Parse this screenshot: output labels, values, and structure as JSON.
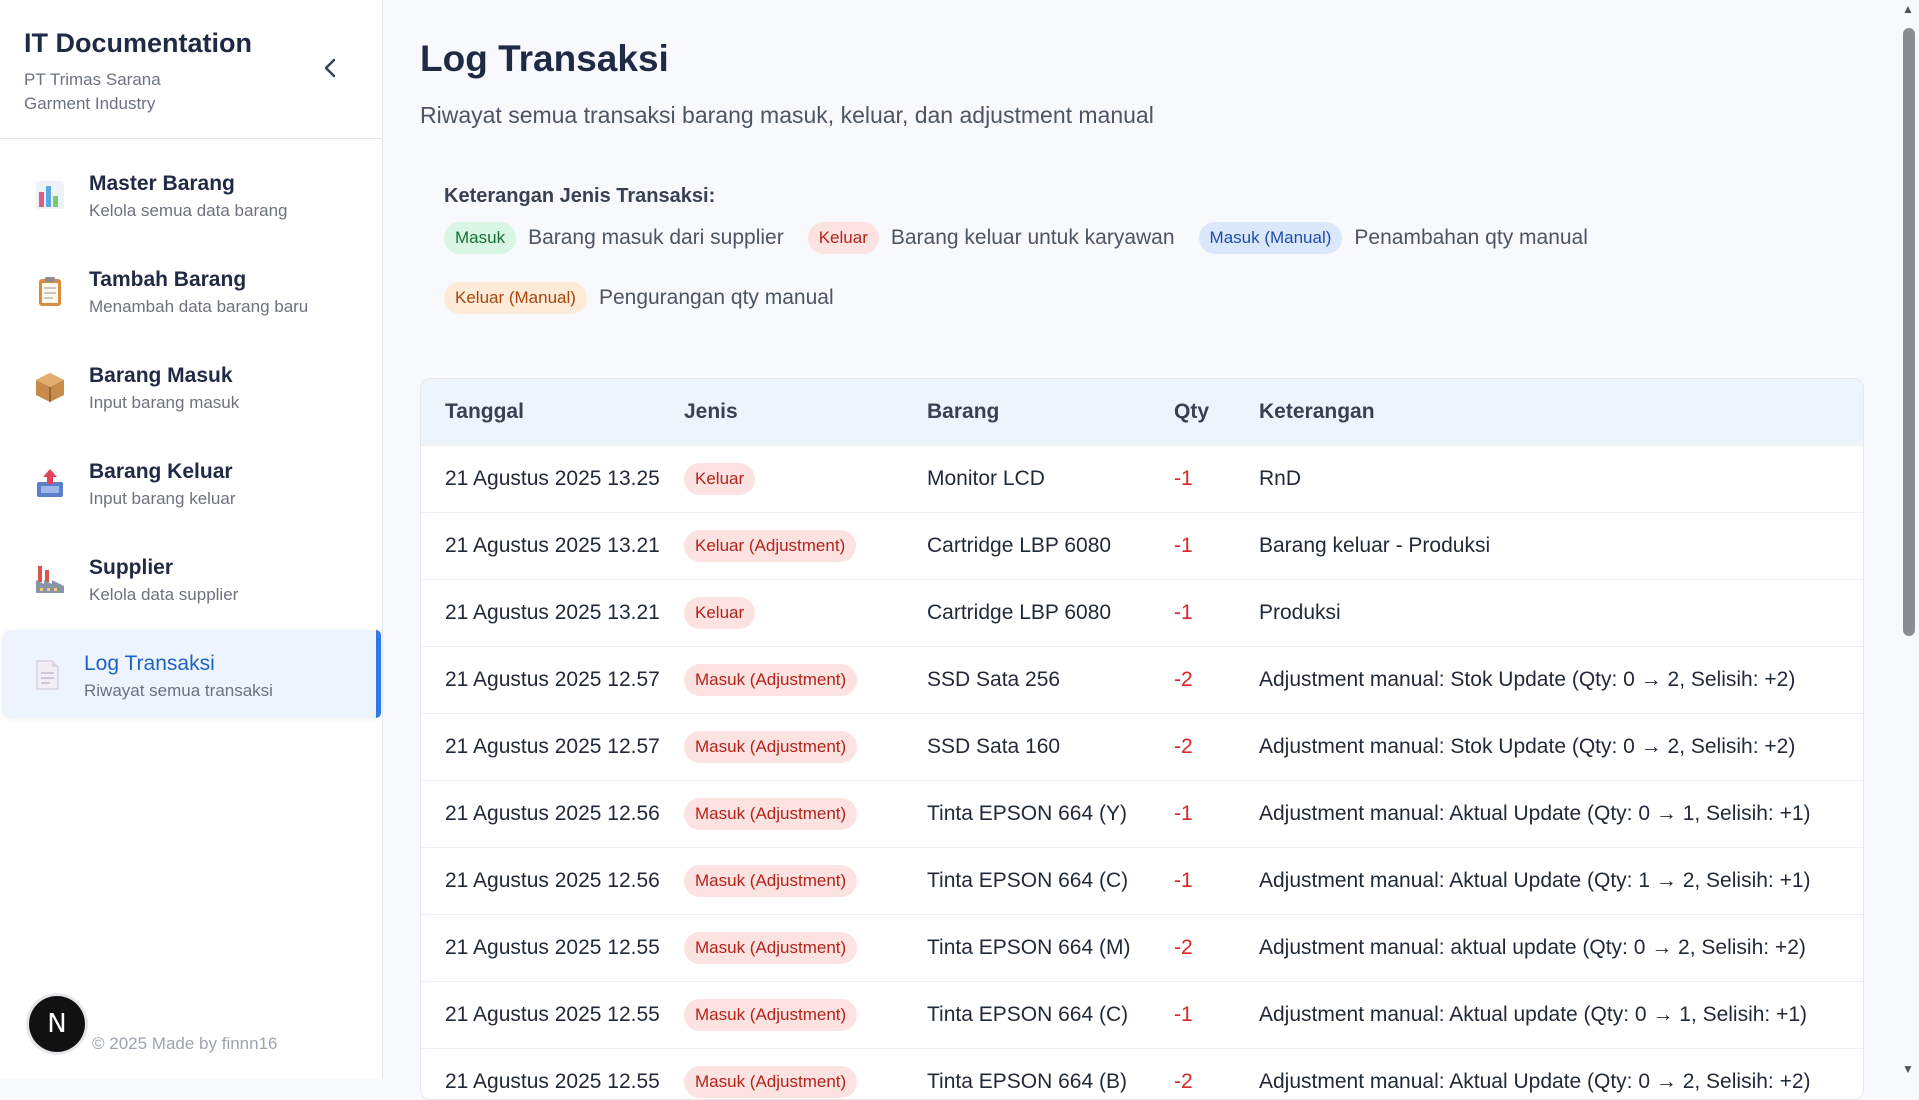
{
  "sidebar": {
    "title": "IT Documentation",
    "subtitle": "PT Trimas Sarana Garment Industry",
    "items": [
      {
        "label": "Master Barang",
        "desc": "Kelola semua data barang",
        "icon": "bar-chart-icon"
      },
      {
        "label": "Tambah Barang",
        "desc": "Menambah data barang baru",
        "icon": "clipboard-icon"
      },
      {
        "label": "Barang Masuk",
        "desc": "Input barang masuk",
        "icon": "package-icon"
      },
      {
        "label": "Barang Keluar",
        "desc": "Input barang keluar",
        "icon": "outbox-icon"
      },
      {
        "label": "Supplier",
        "desc": "Kelola data supplier",
        "icon": "factory-icon"
      },
      {
        "label": "Log Transaksi",
        "desc": "Riwayat semua transaksi",
        "icon": "document-icon",
        "active": true
      }
    ],
    "footer": "© 2025 Made by finnn16",
    "badge_letter": "N"
  },
  "main": {
    "title": "Log Transaksi",
    "subtitle": "Riwayat semua transaksi barang masuk, keluar, dan adjustment manual",
    "legend": {
      "title": "Keterangan Jenis Transaksi:",
      "items": [
        {
          "badge": "Masuk",
          "text": "Barang masuk dari supplier"
        },
        {
          "badge": "Keluar",
          "text": "Barang keluar untuk karyawan"
        },
        {
          "badge": "Masuk (Manual)",
          "text": "Penambahan qty manual"
        },
        {
          "badge": "Keluar (Manual)",
          "text": "Pengurangan qty manual"
        }
      ]
    },
    "table": {
      "headers": [
        "Tanggal",
        "Jenis",
        "Barang",
        "Qty",
        "Keterangan"
      ],
      "rows": [
        [
          "21 Agustus 2025 13.25",
          "Keluar",
          "Monitor LCD",
          "-1",
          "RnD"
        ],
        [
          "21 Agustus 2025 13.21",
          "Keluar (Adjustment)",
          "Cartridge LBP 6080",
          "-1",
          "Barang keluar - Produksi"
        ],
        [
          "21 Agustus 2025 13.21",
          "Keluar",
          "Cartridge LBP 6080",
          "-1",
          "Produksi"
        ],
        [
          "21 Agustus 2025 12.57",
          "Masuk (Adjustment)",
          "SSD Sata 256",
          "-2",
          "Adjustment manual: Stok Update (Qty: 0 → 2, Selisih: +2)"
        ],
        [
          "21 Agustus 2025 12.57",
          "Masuk (Adjustment)",
          "SSD Sata 160",
          "-2",
          "Adjustment manual: Stok Update (Qty: 0 → 2, Selisih: +2)"
        ],
        [
          "21 Agustus 2025 12.56",
          "Masuk (Adjustment)",
          "Tinta EPSON 664 (Y)",
          "-1",
          "Adjustment manual: Aktual Update (Qty: 0 → 1, Selisih: +1)"
        ],
        [
          "21 Agustus 2025 12.56",
          "Masuk (Adjustment)",
          "Tinta EPSON 664 (C)",
          "-1",
          "Adjustment manual: Aktual Update (Qty: 1 → 2, Selisih: +1)"
        ],
        [
          "21 Agustus 2025 12.55",
          "Masuk (Adjustment)",
          "Tinta EPSON 664 (M)",
          "-2",
          "Adjustment manual: aktual update (Qty: 0 → 2, Selisih: +2)"
        ],
        [
          "21 Agustus 2025 12.55",
          "Masuk (Adjustment)",
          "Tinta EPSON 664 (C)",
          "-1",
          "Adjustment manual: Aktual update (Qty: 0 → 1, Selisih: +1)"
        ],
        [
          "21 Agustus 2025 12.55",
          "Masuk (Adjustment)",
          "Tinta EPSON 664 (B)",
          "-2",
          "Adjustment manual: Aktual Update (Qty: 0 → 2, Selisih: +2)"
        ]
      ]
    }
  },
  "colors": {
    "accent": "#2f7ae5",
    "qty_negative": "#dc2626",
    "masuk_badge": "#d9f5e3",
    "keluar_badge": "#fde2e2",
    "masuk_manual_badge": "#dbe8fb",
    "keluar_manual_badge": "#fdebd8"
  }
}
